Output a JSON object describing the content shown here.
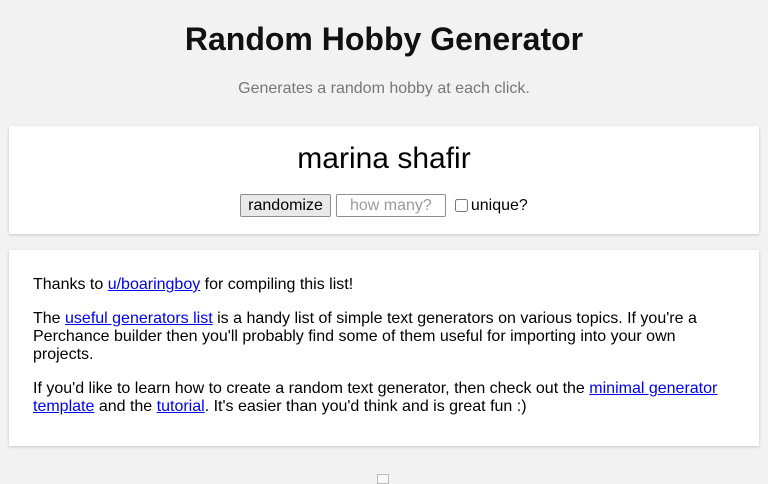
{
  "header": {
    "title": "Random Hobby Generator",
    "subtitle": "Generates a random hobby at each click."
  },
  "generator": {
    "output": "marina shafir",
    "randomize_label": "randomize",
    "count_placeholder": "how many?",
    "count_value": "",
    "unique_label": "unique?",
    "unique_checked": false
  },
  "info": {
    "p1": {
      "before": "Thanks to ",
      "link": "u/boaringboy",
      "after": " for compiling this list!"
    },
    "p2": {
      "before": "The ",
      "link": "useful generators list",
      "after": " is a handy list of simple text generators on various topics. If you're a Perchance builder then you'll probably find some of them useful for importing into your own projects."
    },
    "p3": {
      "before": "If you'd like to learn how to create a random text generator, then check out the ",
      "link1": "minimal generator template",
      "middle": " and the ",
      "link2": "tutorial",
      "after": ". It's easier than you'd think and is great fun :)"
    }
  },
  "colors": {
    "background": "#f2f2f2",
    "card": "#ffffff",
    "link": "#0000ee",
    "subtitle": "#777777"
  },
  "footer": {
    "icon": "image-placeholder-icon"
  }
}
